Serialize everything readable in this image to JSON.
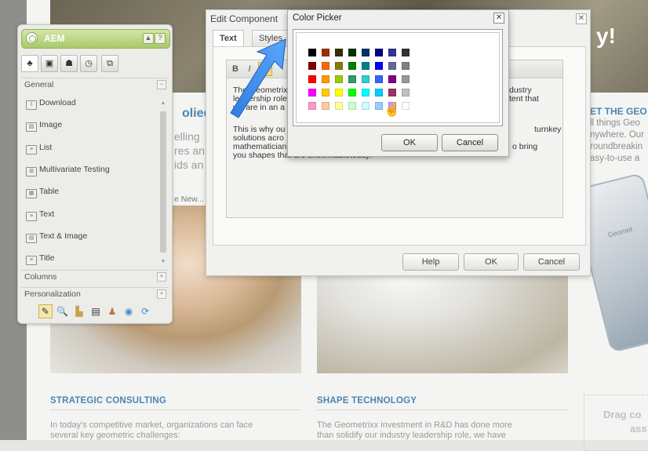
{
  "background": {
    "hero_suffix": "y!",
    "heading_fragment": "olied",
    "fade_lines": [
      "elling",
      "res an",
      "ids an"
    ],
    "more_link": "e New...",
    "right_heading": "ET THE GEO",
    "right_lines": [
      "ll things Geo",
      "nywhere. Our",
      "roundbreakin",
      "asy-to-use a"
    ],
    "phone_label": "Geomet",
    "section_left": {
      "heading": "STRATEGIC CONSULTING",
      "body": [
        "In today's competitive market, organizations can face",
        "several key geometric challenges:"
      ]
    },
    "section_right": {
      "heading": "SHAPE TECHNOLOGY",
      "body": [
        "The Geometrixx investment in R&D has done more",
        "than solidify our industry leadership role, we have"
      ]
    },
    "dropzone_text": [
      "Drag co",
      "ass"
    ]
  },
  "sidekick": {
    "title": "AEM",
    "header_buttons": [
      "▲",
      "?"
    ],
    "tabs": [
      {
        "name": "components-tab",
        "glyph": "♣"
      },
      {
        "name": "page-tab",
        "glyph": "▣"
      },
      {
        "name": "info-tab",
        "glyph": "☗"
      },
      {
        "name": "versioning-tab",
        "glyph": "◷"
      },
      {
        "name": "workflow-tab",
        "glyph": "⧉"
      }
    ],
    "group_general": "General",
    "group_general_toggle": "−",
    "components": [
      "Download",
      "Image",
      "List",
      "Multivariate Testing",
      "Table",
      "Text",
      "Text & Image",
      "Title"
    ],
    "group_columns": "Columns",
    "group_personalization": "Personalization",
    "group_toggle": "+",
    "toolbar_icons": [
      "✎",
      "🔍",
      "▙",
      "▤",
      "♟",
      "◉",
      "⟳"
    ]
  },
  "edit_dialog": {
    "title": "Edit Component",
    "close": "✕",
    "tabs": [
      "Text",
      "Styles"
    ],
    "rte_buttons": [
      "B",
      "I"
    ],
    "paragraph1": [
      "The Geometrixx",
      "dustry",
      "leadership role",
      "tent that",
      "we are in an a"
    ],
    "paragraph2": [
      "This is why ou",
      "turnkey",
      "solutions acro",
      "mathematician",
      "o bring",
      "you shapes that are unthinkabletoday."
    ],
    "help": "Help",
    "ok": "OK",
    "cancel": "Cancel"
  },
  "color_picker": {
    "title": "Color Picker",
    "close": "✕",
    "rows": [
      [
        "#000000",
        "#993300",
        "#333300",
        "#003300",
        "#003366",
        "#000080",
        "#333399",
        "#333333"
      ],
      [
        "#800000",
        "#ff6600",
        "#808000",
        "#008000",
        "#008080",
        "#0000ff",
        "#666699",
        "#808080"
      ],
      [
        "#ff0000",
        "#ff9900",
        "#99cc00",
        "#339966",
        "#33cccc",
        "#3366ff",
        "#800080",
        "#999999"
      ],
      [
        "#ff00ff",
        "#ffcc00",
        "#ffff00",
        "#00ff00",
        "#00ffff",
        "#00ccff",
        "#993366",
        "#c0c0c0"
      ],
      [
        "#ff99cc",
        "#ffcc99",
        "#ffff99",
        "#ccffcc",
        "#ccffff",
        "#99ccff",
        "#cc99ff",
        "#ffffff"
      ]
    ],
    "ok": "OK",
    "cancel": "Cancel"
  }
}
